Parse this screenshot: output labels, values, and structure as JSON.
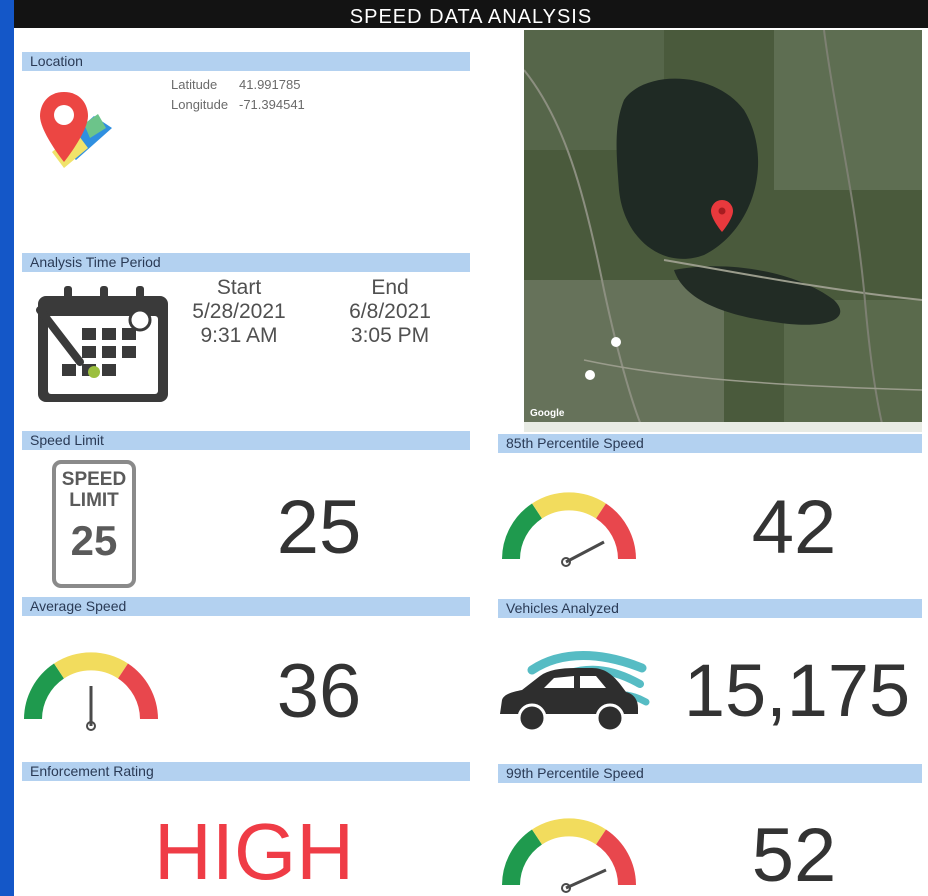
{
  "title": "SPEED DATA ANALYSIS",
  "location": {
    "header": "Location",
    "latitude_label": "Latitude",
    "latitude_value": "41.991785",
    "longitude_label": "Longitude",
    "longitude_value": "-71.394541"
  },
  "map": {
    "attribution": "Google"
  },
  "time_period": {
    "header": "Analysis Time Period",
    "start_label": "Start",
    "start_date": "5/28/2021",
    "start_time": "9:31 AM",
    "end_label": "End",
    "end_date": "6/8/2021",
    "end_time": "3:05 PM"
  },
  "speed_limit": {
    "header": "Speed Limit",
    "sign_line1": "SPEED",
    "sign_line2": "LIMIT",
    "sign_value": "25",
    "value": "25"
  },
  "percentile_85": {
    "header": "85th Percentile Speed",
    "value": "42"
  },
  "average_speed": {
    "header": "Average Speed",
    "value": "36"
  },
  "vehicles": {
    "header": "Vehicles Analyzed",
    "value": "15,175"
  },
  "enforcement": {
    "header": "Enforcement Rating",
    "value": "HIGH"
  },
  "percentile_99": {
    "header": "99th Percentile Speed",
    "value": "52"
  },
  "colors": {
    "header_bg": "#b3d1f0",
    "gauge_green": "#1f9a4e",
    "gauge_yellow": "#f2dc5d",
    "gauge_red": "#e8474d",
    "enforcement_red": "#ef3c46",
    "border_blue": "#1457c8"
  }
}
